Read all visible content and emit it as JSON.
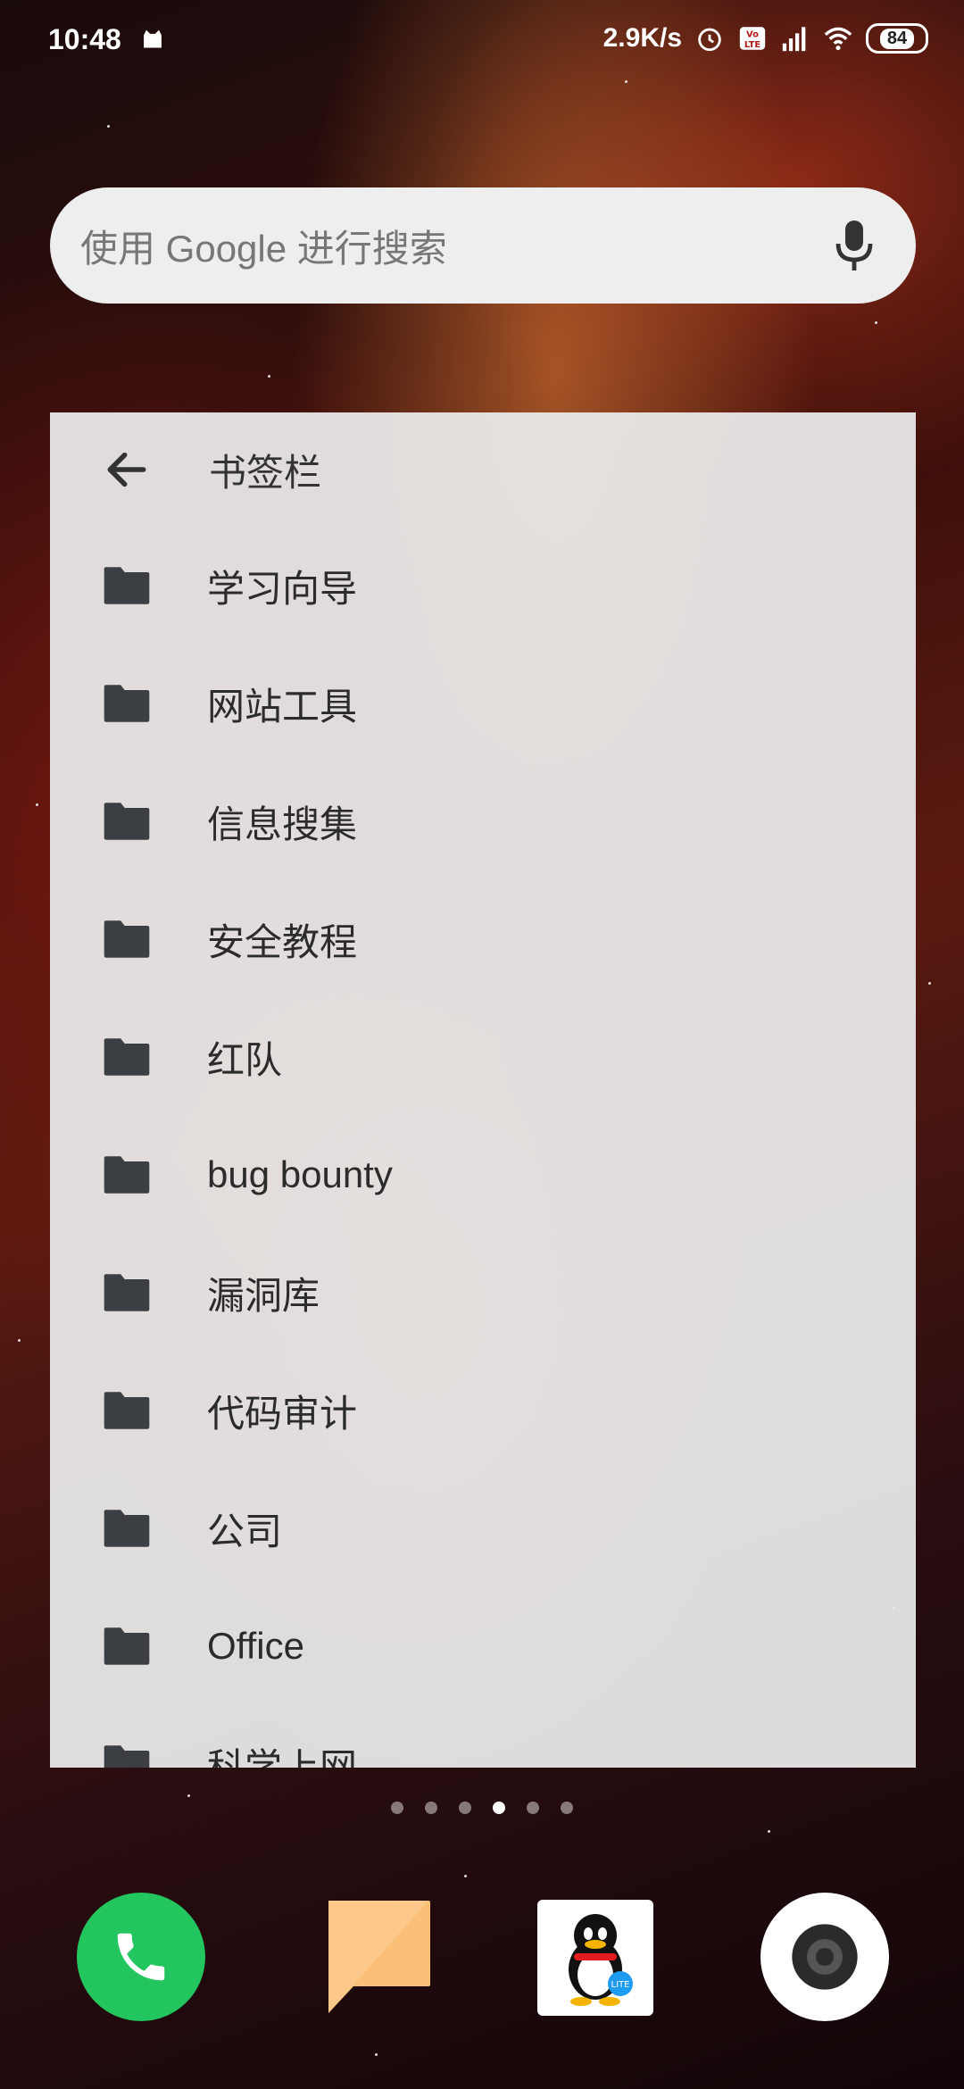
{
  "status_bar": {
    "time": "10:48",
    "net_speed": "2.9K/s",
    "volte": "Vo LTE",
    "battery": "84"
  },
  "search": {
    "placeholder": "使用 Google 进行搜索"
  },
  "bookmarks": {
    "title": "书签栏",
    "folders": [
      "学习向导",
      "网站工具",
      "信息搜集",
      "安全教程",
      "红队",
      "bug bounty",
      "漏洞库",
      "代码审计",
      "公司",
      "Office",
      "科学上网"
    ]
  },
  "page_indicator": {
    "count": 6,
    "active": 4
  },
  "dock": {
    "apps": [
      "phone-icon",
      "messages-icon",
      "qq-lite-icon",
      "camera-icon"
    ],
    "colors": {
      "phone": "#22c55e",
      "messages": "#fbbf77"
    }
  }
}
